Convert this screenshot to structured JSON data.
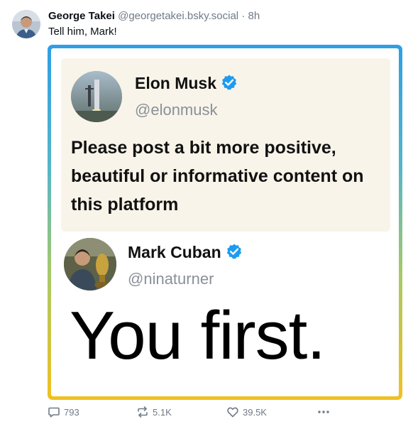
{
  "post": {
    "author": {
      "display_name": "George Takei",
      "handle": "@georgetakei.bsky.social",
      "separator": "·",
      "timestamp": "8h"
    },
    "text": "Tell him, Mark!",
    "embed": {
      "quoted": {
        "name": "Elon Musk",
        "handle": "@elonmusk",
        "text": "Please post a bit more positive, beautiful or informative content on this platform"
      },
      "reply": {
        "name": "Mark Cuban",
        "handle": "@ninaturner",
        "text": "You first."
      }
    },
    "actions": {
      "replies": "793",
      "reposts": "5.1K",
      "likes": "39.5K"
    }
  },
  "colors": {
    "verified_badge": "#1d9bf0",
    "frame_gradient": [
      "#2f9ee6",
      "#a8c968",
      "#f2c020"
    ],
    "quote_card_bg": "#f8f4e9"
  },
  "icons": [
    "reply-icon",
    "repost-icon",
    "like-icon",
    "more-options-icon",
    "verified-badge-icon"
  ]
}
